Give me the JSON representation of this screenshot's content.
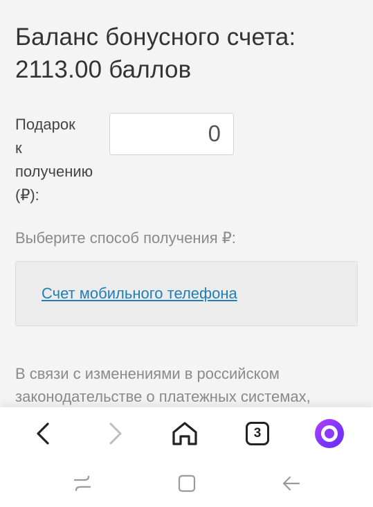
{
  "balance": {
    "title_line1": "Баланс бонусного счета:",
    "title_line2": "2113.00 баллов"
  },
  "gift": {
    "label_lines": [
      "Подарок",
      "к",
      "получению",
      "(₽):"
    ],
    "value": "0"
  },
  "method": {
    "label": "Выберите способ получения ₽:",
    "options": [
      "Счет мобильного телефона"
    ]
  },
  "notice": {
    "line1": "В связи с изменениями в российском",
    "line2": "законодательстве о платежных системах,"
  },
  "browser_nav": {
    "tab_count": "3",
    "icons": [
      "back-icon",
      "forward-icon",
      "home-icon",
      "tabs-icon",
      "alice-icon"
    ]
  },
  "system_nav": {
    "icons": [
      "recent-apps-icon",
      "home-square-icon",
      "back-arrow-icon"
    ]
  },
  "colors": {
    "background": "#f4f4f4",
    "link": "#1f7fb5",
    "muted_text": "#8a8a8a",
    "alice_accent": "#8a3bff"
  }
}
